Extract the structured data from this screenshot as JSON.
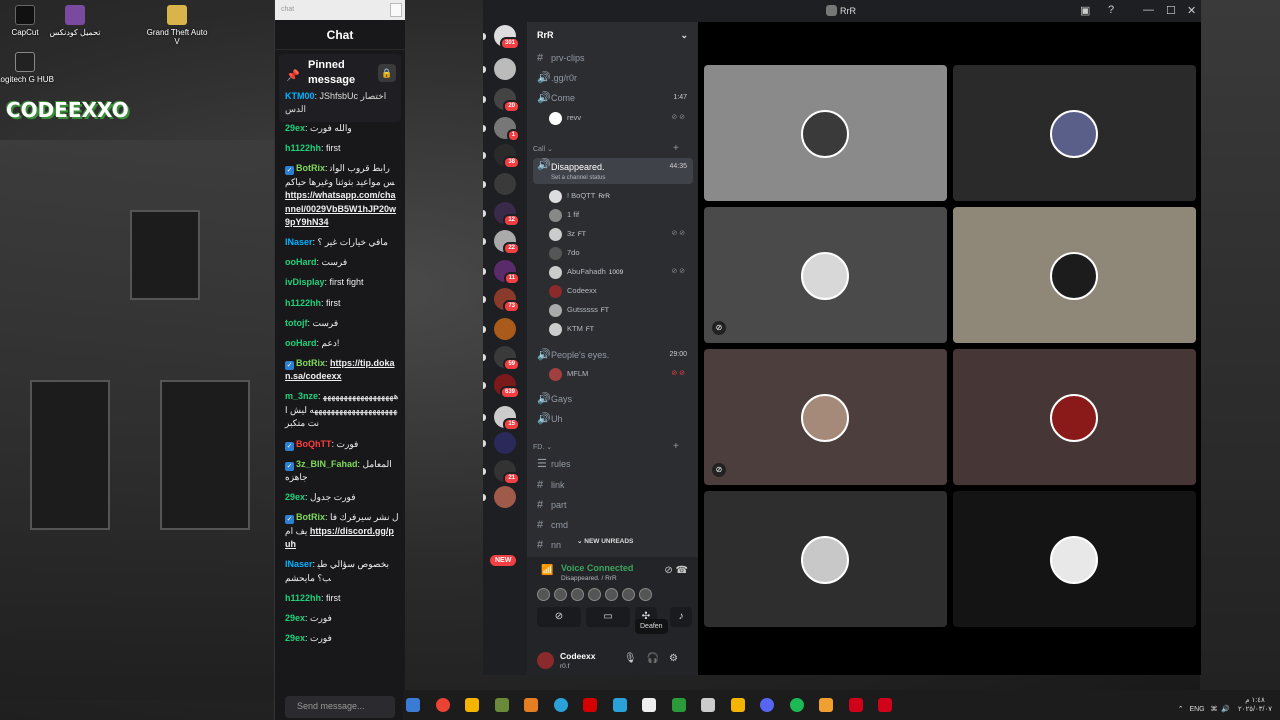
{
  "desktop": {
    "icons": [
      {
        "label": "CapCut",
        "color": "#1a1a1a"
      },
      {
        "label": "تحميل كودنكس",
        "color": "#6b3b8a"
      },
      {
        "label": "Grand Theft Auto V",
        "color": "#d9b44a"
      },
      {
        "label": "Logitech G HUB",
        "color": "#222"
      }
    ],
    "logo_text": "CODEEXXO"
  },
  "chat": {
    "url_placeholder": "chat",
    "header": "Chat",
    "pinned_title": "Pinned message",
    "pinned_user": "KTM00",
    "pinned_text": ": JShfsbUc اختصار الدس",
    "messages": [
      {
        "user": "29ex",
        "color": "#1fd17a",
        "text": ": والله فورت"
      },
      {
        "user": "h1122hh",
        "color": "#1fd17a",
        "text": ": first"
      },
      {
        "user": "BotRix",
        "color": "#7ed957",
        "bot": true,
        "text": ": رابط قروب الواتس مواعيد بثوثنا وغيرها حياكم ",
        "link": "https://whatsapp.com/channel/0029VbB5W1hJP20w9pY9hN34"
      },
      {
        "user": "INaser",
        "color": "#00b2ff",
        "text": ": مافي خيارات غير ؟"
      },
      {
        "user": "ooHard",
        "color": "#1fd17a",
        "text": ": فرست"
      },
      {
        "user": "ivDisplay",
        "color": "#1fd17a",
        "text": ": first fight"
      },
      {
        "user": "h1122hh",
        "color": "#1fd17a",
        "text": ": first"
      },
      {
        "user": "totojf",
        "color": "#1fd17a",
        "text": ": فرست"
      },
      {
        "user": "ooHard",
        "color": "#1fd17a",
        "text": ": دعم!"
      },
      {
        "user": "BotRix",
        "color": "#7ed957",
        "bot": true,
        "text": ": ",
        "link": "https://tip.dokan.sa/codeexx"
      },
      {
        "user": "m_3nze",
        "color": "#1fd17a",
        "text": ": ههههههههههههههههههههههههههههههههههههههه ليش انت متكبر"
      },
      {
        "user": "BoQhTT",
        "color": "#ff3b3b",
        "bot": true,
        "text": ": فورت"
      },
      {
        "user": "3z_BIN_Fahad",
        "color": "#7ed957",
        "bot": true,
        "text": ": المعامل جاهزه"
      },
      {
        "user": "29ex",
        "color": "#1fd17a",
        "text": ": فورت جدول"
      },
      {
        "user": "BotRix",
        "color": "#7ed957",
        "bot": true,
        "text": ": ل نشر سيرفرك فايف ام ",
        "link": "https://discord.gg/puh"
      },
      {
        "user": "INaser",
        "color": "#00b2ff",
        "text": ": بخصوص سؤالي طيب؟ مايحشم"
      },
      {
        "user": "h1122hh",
        "color": "#1fd17a",
        "text": ": first"
      },
      {
        "user": "29ex",
        "color": "#1fd17a",
        "text": ": فورت"
      },
      {
        "user": "29ex",
        "color": "#1fd17a",
        "text": ": فورت"
      }
    ],
    "input_placeholder": "Send message..."
  },
  "discord": {
    "window_title": "RrR",
    "server_counts": [
      "301",
      "20",
      "1",
      "38",
      "12",
      "22",
      "11",
      "73",
      "59",
      "639",
      "15",
      "21"
    ],
    "new_label": "NEW",
    "guild_name": "RrR",
    "channels_top": [
      {
        "name": "prv-clips",
        "icon": "#"
      },
      {
        "name": ".gg/r0r",
        "icon": "🔊"
      },
      {
        "name": "Come",
        "icon": "🔊",
        "time": "1:47"
      }
    ],
    "come_user": "revv",
    "category_call": "Call",
    "active_channel": {
      "name": "Disappeared.",
      "status": "Set a channel status",
      "time": "44:35"
    },
    "voice_users": [
      {
        "name": "! BoQTT",
        "tag": "RrR"
      },
      {
        "name": "1 fif",
        "tag": ""
      },
      {
        "name": "3z",
        "tag": "FT"
      },
      {
        "name": "7do",
        "tag": ""
      },
      {
        "name": "AbuFahadh",
        "tag": "1009"
      },
      {
        "name": "Codeexx",
        "tag": ""
      },
      {
        "name": "Gutsssss",
        "tag": "FT"
      },
      {
        "name": "KTM",
        "tag": "FT"
      }
    ],
    "peoples_eyes": {
      "name": "People's eyes.",
      "time": "29:00"
    },
    "peoples_user": "MFLM",
    "more_channels": [
      "Gays",
      "Uh"
    ],
    "category_fd": "FD.",
    "fd_channels": [
      "rules",
      "link",
      "part",
      "cmd",
      "nn"
    ],
    "new_unreads": "NEW UNREADS",
    "voice": {
      "title": "Voice Connected",
      "sub": "Disappeared. / RrR"
    },
    "tooltip": "Deafen",
    "user": {
      "name": "Codeexx",
      "status": "r0.f"
    },
    "tiles": [
      {
        "bg": "#8a8a8a",
        "face": "#3a3a3a",
        "muted": false
      },
      {
        "bg": "#2a2a2a",
        "face": "#5a5f8a",
        "muted": false
      },
      {
        "bg": "#4a4a4a",
        "face": "#d8d8d8",
        "muted": true
      },
      {
        "bg": "#8f8878",
        "face": "#1c1c1c",
        "muted": false
      },
      {
        "bg": "#4d3e3e",
        "face": "#a58a7a",
        "muted": true
      },
      {
        "bg": "#463636",
        "face": "#8a1a1a",
        "muted": false
      },
      {
        "bg": "#2e2e2e",
        "face": "#c8c8c8",
        "muted": false
      },
      {
        "bg": "#141414",
        "face": "#e8e8e8",
        "muted": false
      }
    ]
  },
  "taskbar": {
    "lang": "ENG",
    "time": "١:٤٨ م",
    "date": "٢٠٢٥/٠٣/٠٧"
  },
  "colors": {
    "discord_green": "#3ba55d",
    "badge_red": "#f23f43",
    "link_blue": "#9eb8ff"
  }
}
